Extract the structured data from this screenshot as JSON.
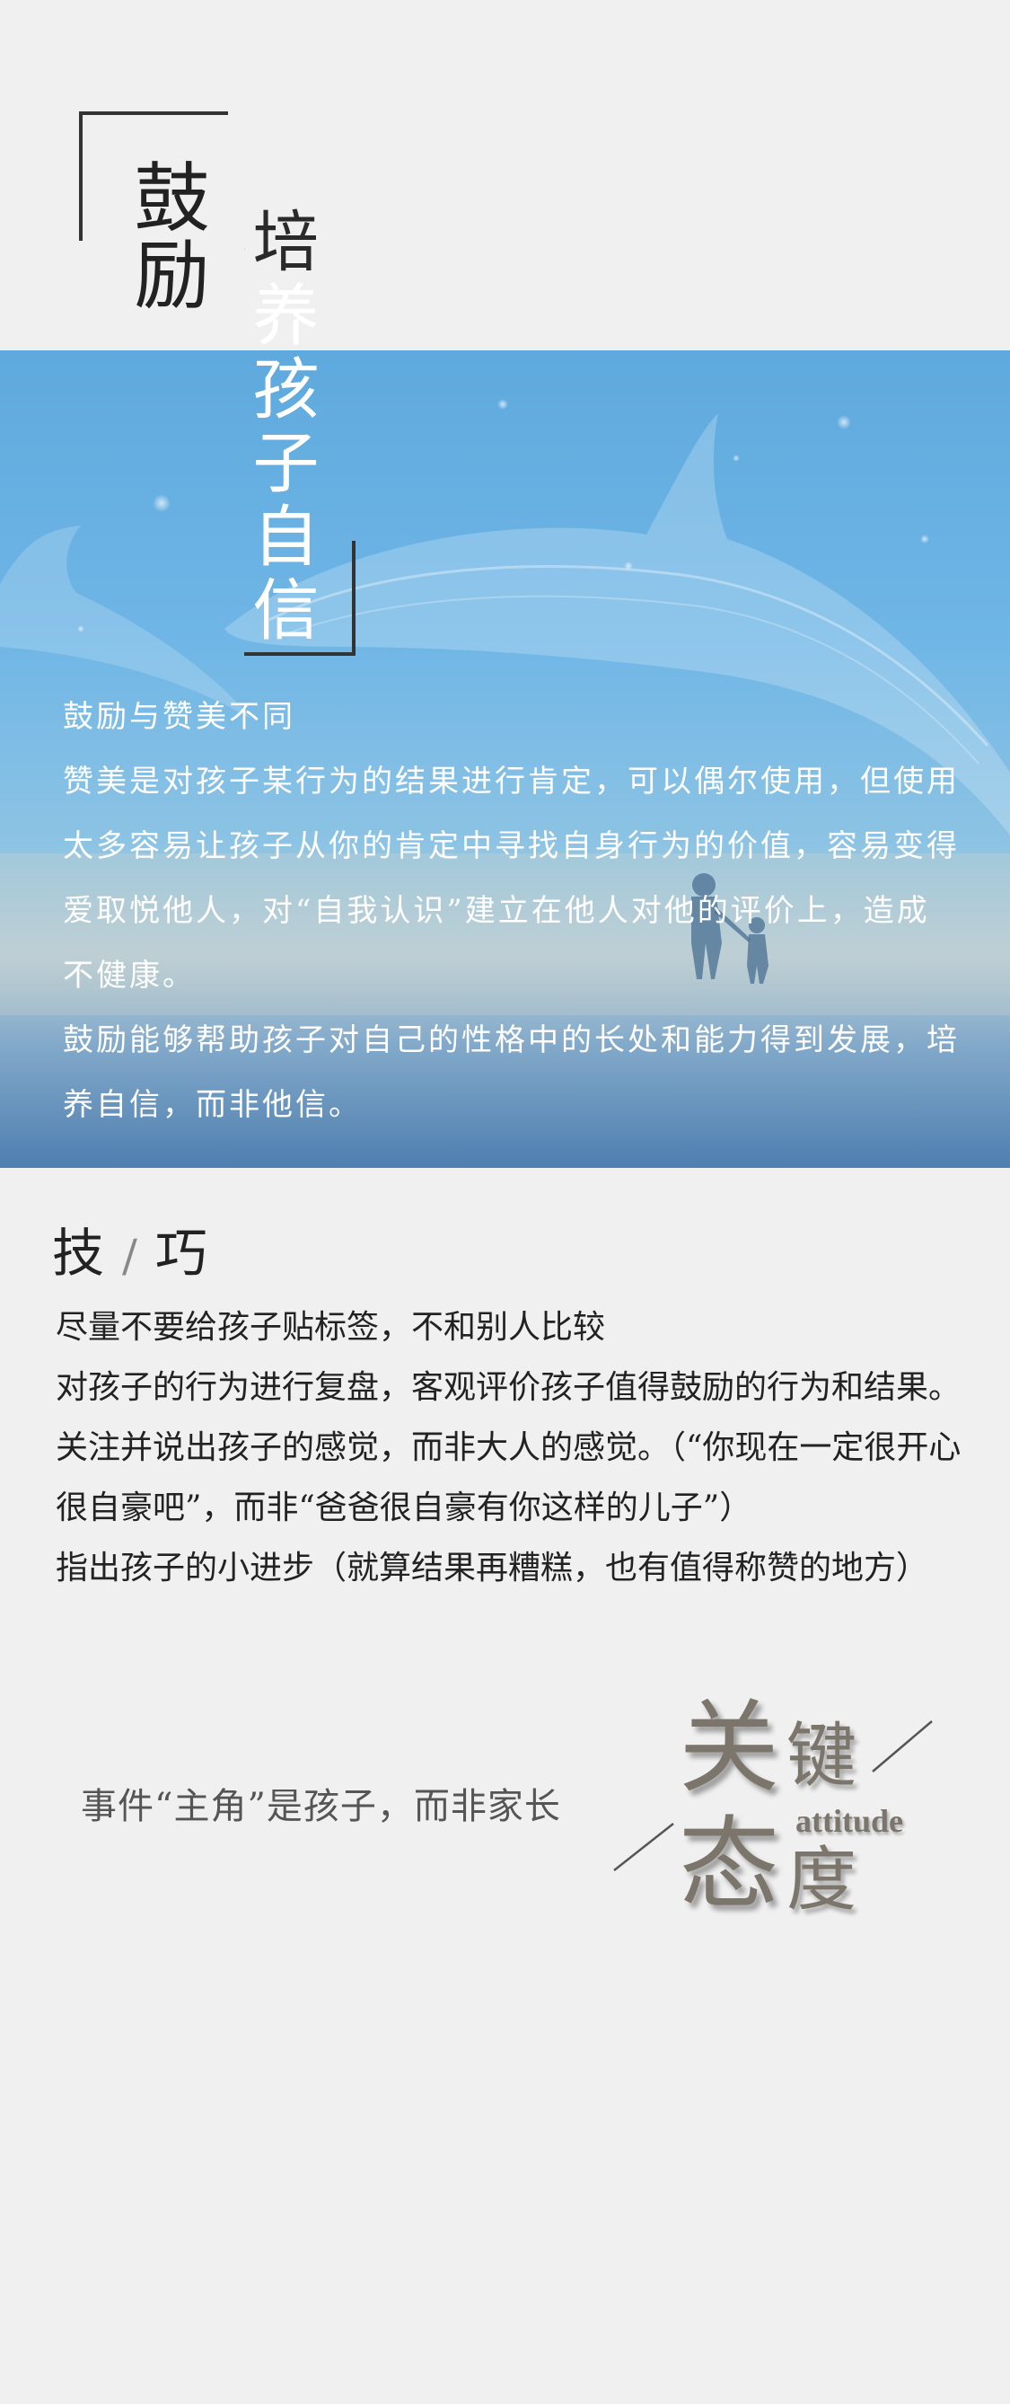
{
  "title": {
    "main": "鼓励",
    "sub": "培养孩子自信"
  },
  "banner": {
    "paragraphs": [
      "鼓励与赞美不同",
      "赞美是对孩子某行为的结果进行肯定，可以偶尔使用，但使用太多容易让孩子从你的肯定中寻找自身行为的价值，容易变得爱取悦他人，对“自我认识”建立在他人对他的评价上，造成不健康。",
      "鼓励能够帮助孩子对自己的性格中的长处和能力得到发展，培养自信，而非他信。"
    ]
  },
  "tips": {
    "heading_left": "技",
    "heading_sep": "/",
    "heading_right": "巧",
    "items": [
      "尽量不要给孩子贴标签，不和别人比较",
      "对孩子的行为进行复盘，客观评价孩子值得鼓励的行为和结果。",
      "关注并说出孩子的感觉，而非大人的感觉。（“你现在一定很开心很自豪吧”，而非“爸爸很自豪有你这样的儿子”）",
      "指出孩子的小进步（就算结果再糟糕，也有值得称赞的地方）"
    ]
  },
  "key": {
    "statement": "事件“主角”是孩子，而非家长",
    "logo_char1": "关",
    "logo_char2": "键",
    "logo_char3": "态",
    "logo_char4": "度",
    "logo_word": "attitude"
  },
  "colors": {
    "background": "#f0f0f0",
    "banner_blue": "#6fb6e6",
    "text_dark": "#222222",
    "logo_brown": "#7b756b"
  }
}
